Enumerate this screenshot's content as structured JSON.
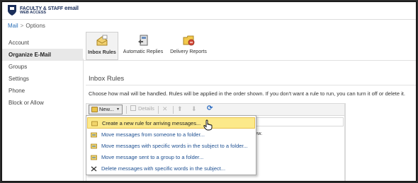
{
  "header": {
    "brand_line1_small": "FACULTY & STAFF",
    "brand_line1_big": "email",
    "brand_line2": "WEB ACCESS"
  },
  "breadcrumb": [
    "Mail",
    "Options"
  ],
  "sidebar": {
    "items": [
      {
        "label": "Account"
      },
      {
        "label": "Organize E-Mail",
        "active": true
      },
      {
        "label": "Groups"
      },
      {
        "label": "Settings"
      },
      {
        "label": "Phone"
      },
      {
        "label": "Block or Allow"
      }
    ]
  },
  "tabs": [
    {
      "label": "Inbox Rules",
      "icon": "inbox-rules-icon",
      "selected": true
    },
    {
      "label": "Automatic Replies",
      "icon": "automatic-replies-icon",
      "selected": false
    },
    {
      "label": "Delivery Reports",
      "icon": "delivery-reports-icon",
      "selected": false
    }
  ],
  "section": {
    "title": "Inbox Rules",
    "description": "Choose how mail will be handled. Rules will be applied in the order shown. If you don't want a rule to run, you can turn it off or delete it."
  },
  "toolbar": {
    "new_label": "New...",
    "details_label": "Details"
  },
  "list": {
    "hint_fragment": "ew."
  },
  "menu": {
    "items": [
      {
        "label": "Create a new rule for arriving messages...",
        "icon": "rule-new-icon",
        "highlighted": true
      },
      {
        "label": "Move messages from someone to a folder...",
        "icon": "move-rule-icon"
      },
      {
        "label": "Move messages with specific words in the subject to a folder...",
        "icon": "move-rule-icon"
      },
      {
        "label": "Move message sent to a group to a folder...",
        "icon": "move-rule-icon"
      },
      {
        "label": "Delete messages with specific words in the subject...",
        "icon": "delete-x-icon"
      }
    ]
  },
  "colors": {
    "link": "#2a6fb7",
    "menu_highlight": "#fce98a",
    "brand": "#1a2e5a"
  }
}
